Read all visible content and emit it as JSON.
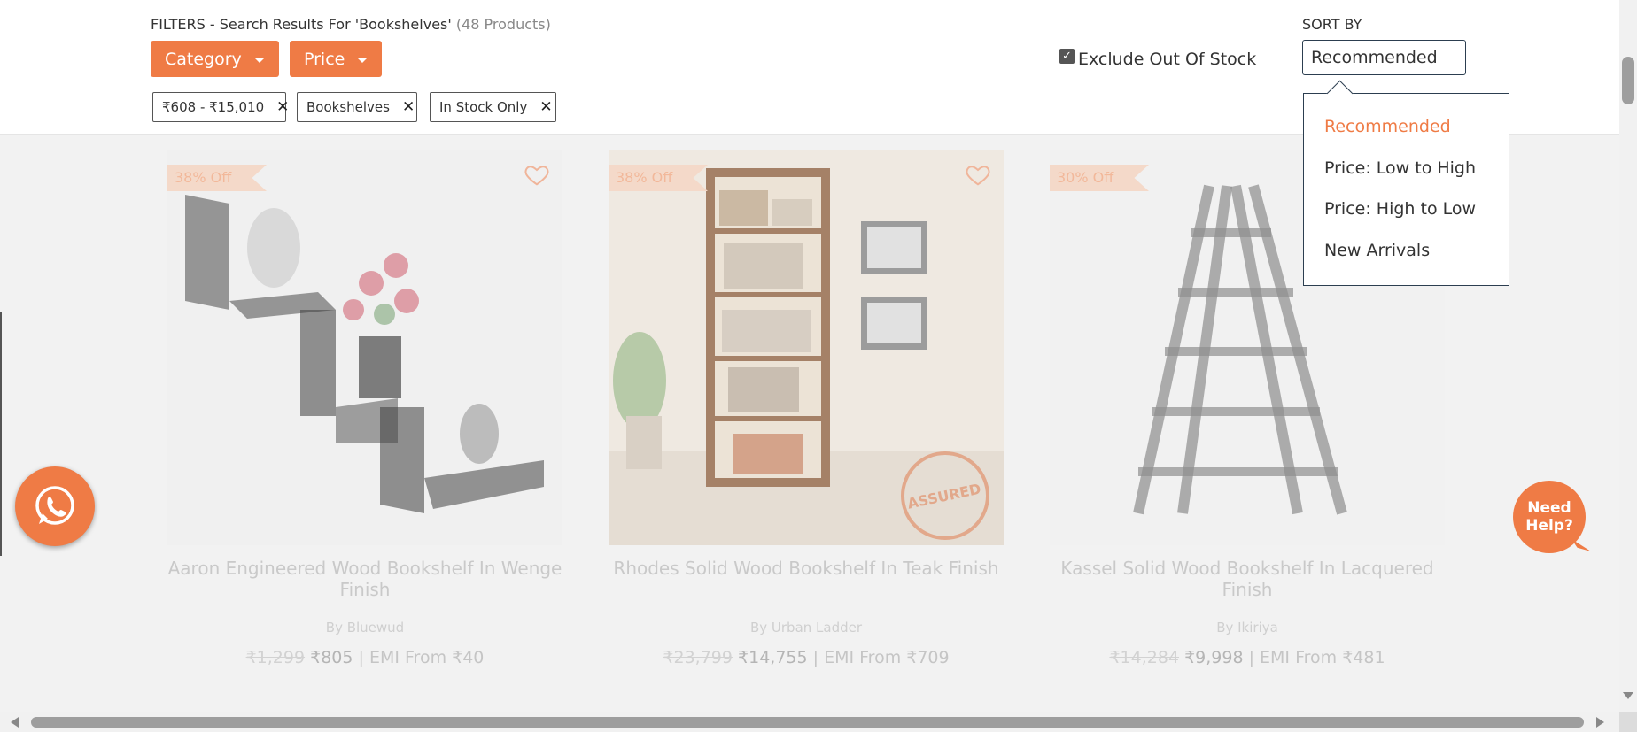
{
  "filters": {
    "title": "FILTERS - Search Results For 'Bookshelves'",
    "count": "(48 Products)",
    "category_label": "Category",
    "price_label": "Price",
    "chips": [
      "₹608 - ₹15,010",
      "Bookshelves",
      "In Stock Only"
    ]
  },
  "exclude_out_of_stock": {
    "label": "Exclude Out Of Stock",
    "checked": true
  },
  "sort": {
    "label": "SORT BY",
    "selected": "Recommended",
    "options": [
      "Recommended",
      "Price: Low to High",
      "Price: High to Low",
      "New Arrivals"
    ]
  },
  "products": [
    {
      "discount": "38% Off",
      "title": "Aaron Engineered Wood Bookshelf In Wenge Finish",
      "brand": "By Bluewud",
      "old_price": "₹1,299",
      "price": "₹805",
      "emi": "| EMI From ₹40"
    },
    {
      "discount": "38% Off",
      "title": "Rhodes Solid Wood Bookshelf In Teak Finish",
      "brand": "By Urban Ladder",
      "old_price": "₹23,799",
      "price": "₹14,755",
      "emi": "| EMI From ₹709",
      "stamp_text": "ASSURED"
    },
    {
      "discount": "30% Off",
      "title": "Kassel Solid Wood Bookshelf In Lacquered Finish",
      "brand": "By Ikiriya",
      "old_price": "₹14,284",
      "price": "₹9,998",
      "emi": "| EMI From ₹481"
    }
  ],
  "help_button": "Need Help?",
  "colors": {
    "accent": "#ef7b45",
    "border_dark": "#2c3e50"
  }
}
